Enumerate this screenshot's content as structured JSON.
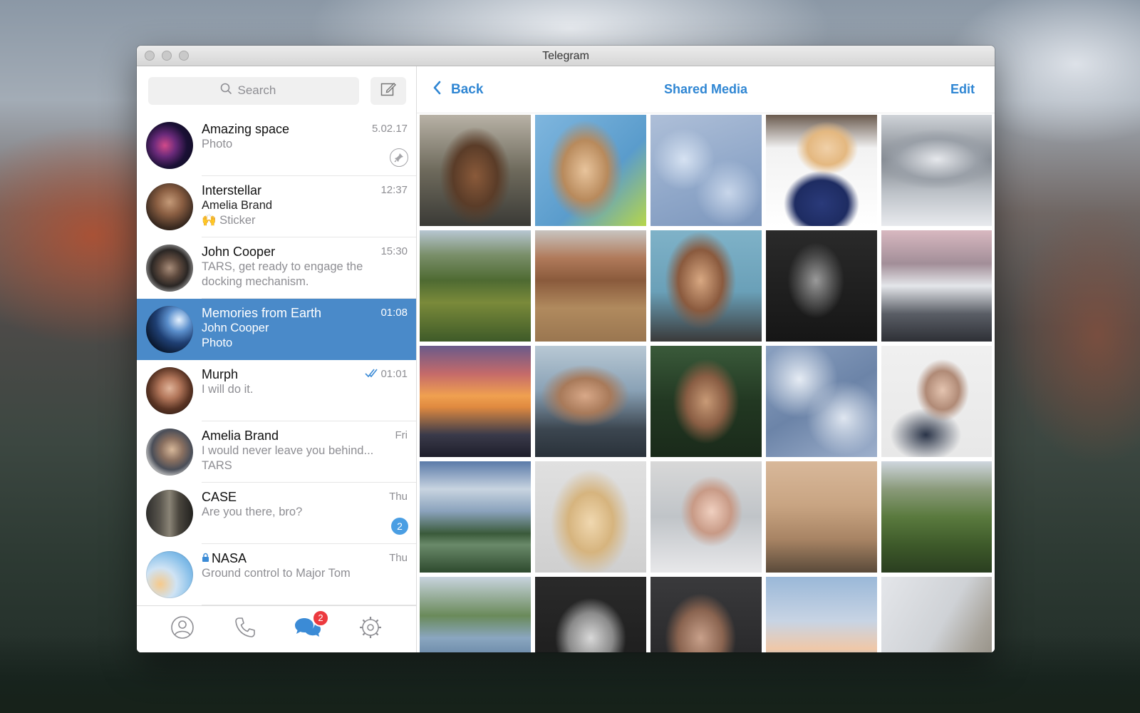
{
  "window": {
    "title": "Telegram"
  },
  "sidebar": {
    "search": {
      "placeholder": "Search"
    },
    "chats": [
      {
        "name": "Amazing space",
        "time": "5.02.17",
        "lines": [
          "Photo"
        ],
        "pinned": true
      },
      {
        "name": "Interstellar",
        "time": "12:37",
        "sender": "Amelia Brand",
        "lines": [
          "🙌 Sticker"
        ]
      },
      {
        "name": "John Cooper",
        "time": "15:30",
        "lines": [
          "TARS, get ready to engage the",
          "docking mechanism."
        ]
      },
      {
        "name": "Memories from Earth",
        "time": "01:08",
        "sender": "John Cooper",
        "lines": [
          "Photo"
        ],
        "selected": true
      },
      {
        "name": "Murph",
        "time": "01:01",
        "lines": [
          "I will do it."
        ],
        "read": true
      },
      {
        "name": "Amelia Brand",
        "time": "Fri",
        "lines": [
          "I would never leave you behind...",
          "TARS"
        ]
      },
      {
        "name": "CASE",
        "time": "Thu",
        "lines": [
          "Are you there, bro?"
        ],
        "unread": "2"
      },
      {
        "name": "NASA",
        "time": "Thu",
        "lines": [
          "Ground control to Major Tom"
        ],
        "secret": true
      }
    ],
    "tabs": {
      "contacts": "contacts-icon",
      "calls": "phone-icon",
      "chats": "chats-icon",
      "chats_badge": "2",
      "settings": "settings-icon"
    }
  },
  "main": {
    "back_label": "Back",
    "title": "Shared Media",
    "edit_label": "Edit"
  },
  "colors": {
    "accent": "#2f86d3",
    "selected_row": "#4a8ac9",
    "badge_blue": "#4a9ee3",
    "badge_red": "#ec3a3f"
  }
}
